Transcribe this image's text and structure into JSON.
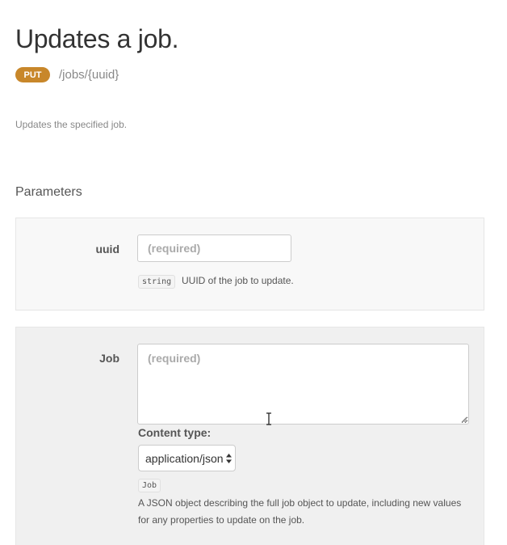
{
  "endpoint": {
    "title": "Updates a job.",
    "method": "PUT",
    "path": "/jobs/{uuid}",
    "description": "Updates the specified job.",
    "method_color": "#c8872a"
  },
  "parameters": {
    "section_title": "Parameters",
    "uuid": {
      "label": "uuid",
      "value": "",
      "placeholder": "(required)",
      "type": "string",
      "description": "UUID of the job to update."
    },
    "job": {
      "label": "Job",
      "value": "",
      "placeholder": "(required)",
      "content_type_label": "Content type:",
      "content_type_value": "application/json",
      "type": "Job",
      "description": "A JSON object describing the full job object to update, including new values for any properties to update on the job."
    }
  },
  "icons": {
    "select_arrows": "updown-arrows-icon",
    "textarea_grip": "resize-grip-icon",
    "cursor": "text-cursor-icon"
  }
}
